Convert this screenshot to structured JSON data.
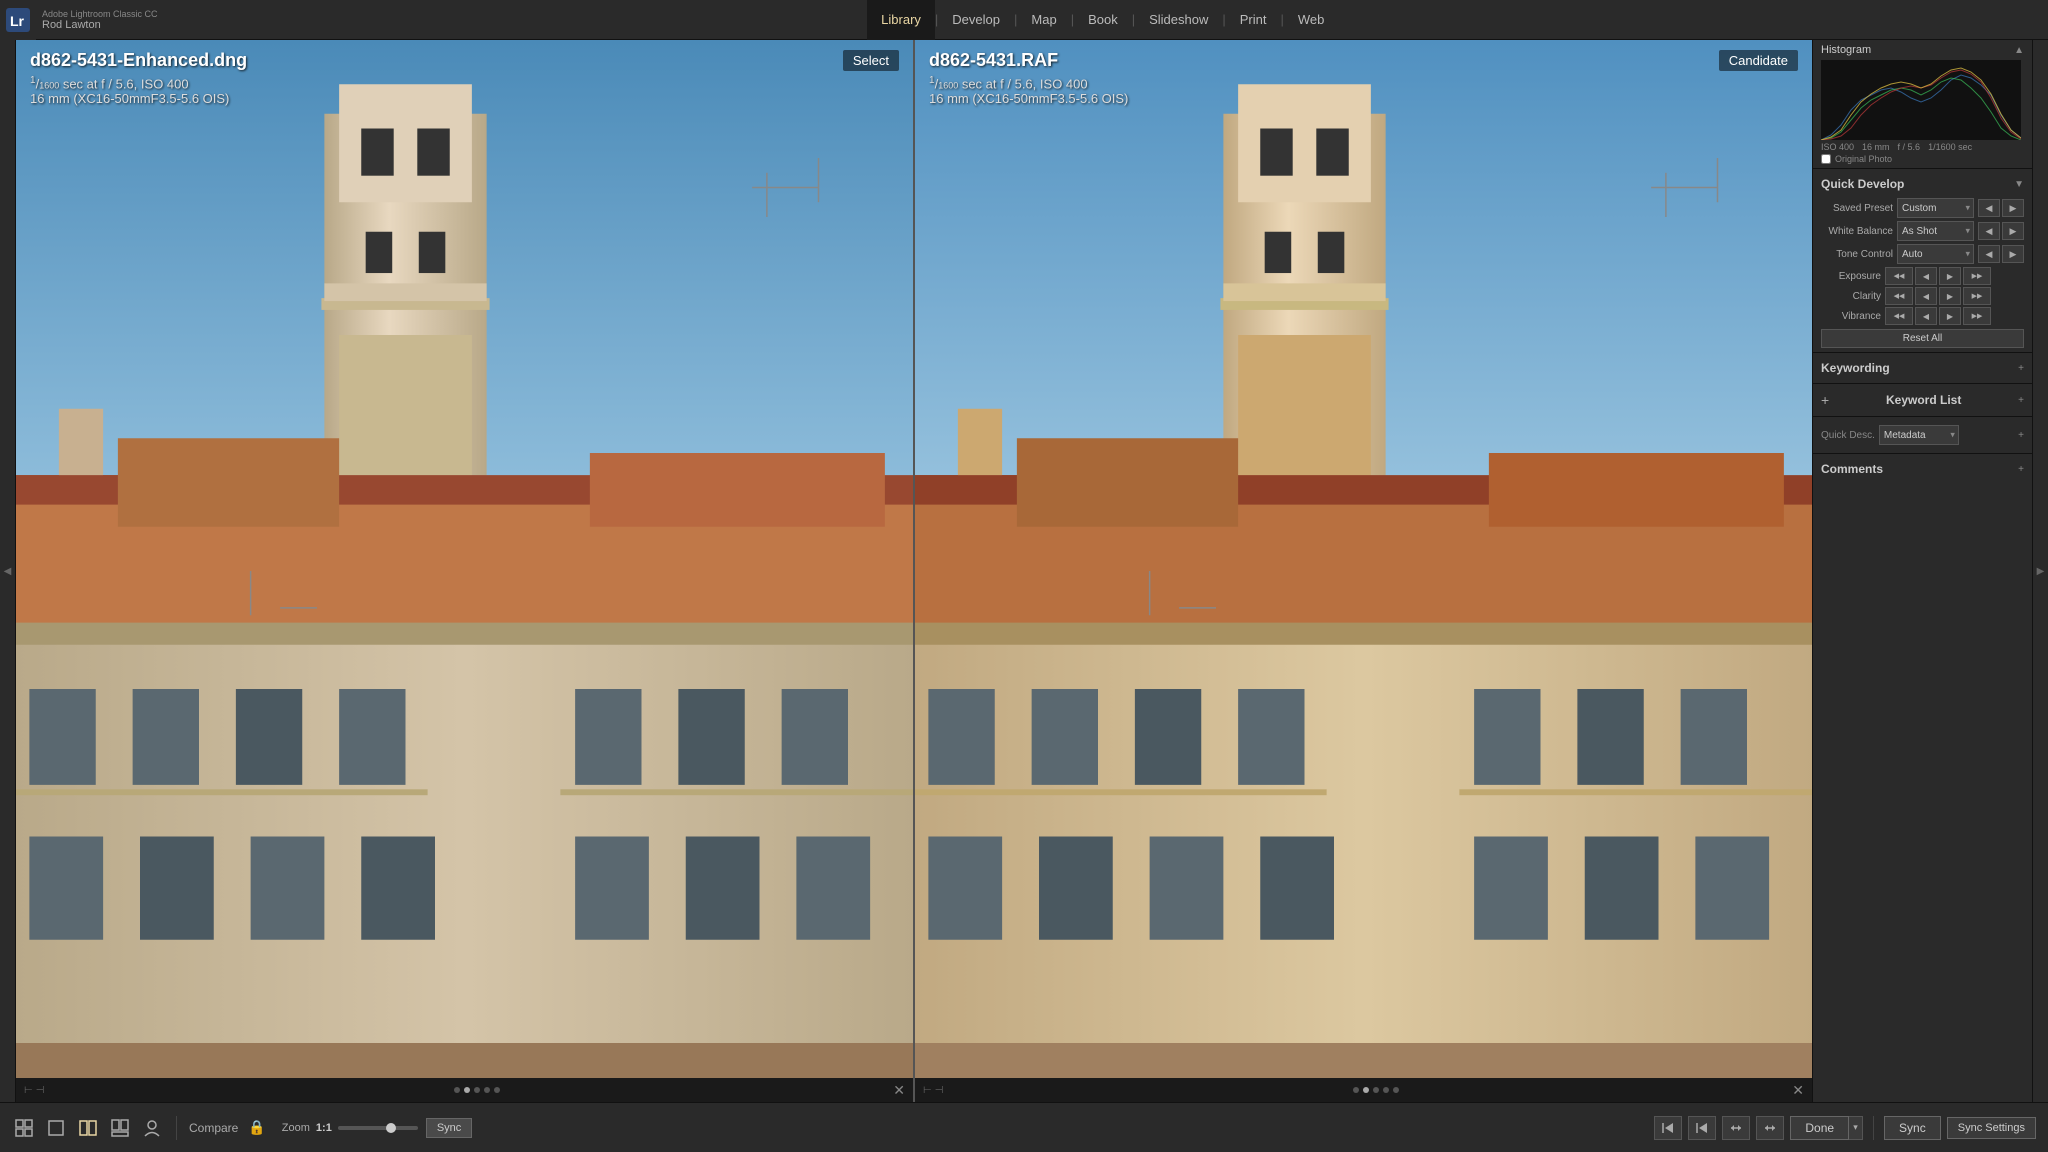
{
  "app": {
    "name": "Adobe Lightroom Classic CC",
    "logo": "Lr",
    "user": "Rod Lawton"
  },
  "nav": {
    "items": [
      "Library",
      "Develop",
      "Map",
      "Book",
      "Slideshow",
      "Print",
      "Web"
    ],
    "active": "Library"
  },
  "left_photo": {
    "filename": "d862-5431-Enhanced.dng",
    "shutter": "1/1600",
    "aperture": "f / 5.6",
    "iso": "ISO 400",
    "lens": "16 mm (XC16-50mmF3.5-5.6 OIS)",
    "label": "Select"
  },
  "right_photo": {
    "filename": "d862-5431.RAF",
    "shutter": "1/1600",
    "aperture": "f / 5.6",
    "iso": "ISO 400",
    "lens": "16 mm (XC16-50mmF3.5-5.6 OIS)",
    "label": "Candidate"
  },
  "histogram": {
    "title": "Histogram",
    "meta": [
      "ISO 400",
      "16 mm",
      "f / 5.6",
      "1/1600 sec"
    ],
    "original_photo_label": "Original Photo"
  },
  "quick_develop": {
    "title": "Quick Develop",
    "saved_preset_label": "Saved Preset",
    "saved_preset_value": "Custom",
    "white_balance_label": "White Balance",
    "white_balance_value": "As Shot",
    "tone_control_label": "Tone Control",
    "tone_control_value": "Auto",
    "exposure_label": "Exposure",
    "clarity_label": "Clarity",
    "vibrance_label": "Vibrance",
    "reset_all_label": "Reset All",
    "btn_labels": {
      "dbl_left": "◀◀",
      "sgl_left": "◀",
      "sgl_right": "▶",
      "dbl_right": "▶▶"
    }
  },
  "keywording": {
    "title": "Keywording"
  },
  "keyword_list": {
    "title": "Keyword List",
    "plus_label": "+"
  },
  "metadata": {
    "title": "Metadata",
    "quick_desc_label": "Quick Desc.",
    "dropdown_arrow": "▾"
  },
  "comments": {
    "title": "Comments"
  },
  "toolbar": {
    "grid_icon": "⊞",
    "loupe_icon": "⬜",
    "compare_icon": "⬜⬜",
    "survey_icon": "⬛",
    "people_icon": "👤",
    "compare_label": "Compare",
    "zoom_label": "Zoom",
    "zoom_value": "1:1",
    "sync_label": "Sync",
    "done_label": "Done",
    "sync_settings_label": "Sync Settings",
    "sync_label_right": "Sync"
  },
  "bottom_arrows": {
    "skip_back": "⏮",
    "prev": "◀",
    "next": "▶",
    "skip_fwd": "⏭"
  },
  "colors": {
    "hist_blue": "#3a7abf",
    "hist_green": "#3abf5a",
    "hist_red": "#bf3a3a",
    "hist_yellow": "#d4b840",
    "hist_white": "#999",
    "sky_top": "#5b9ac9",
    "sky_bottom": "#a8cfe0",
    "building_light": "#d4c4aa",
    "building_shadow": "#c8b89a",
    "roof_tile": "#a05840",
    "active_nav": "#e8d5a3"
  }
}
